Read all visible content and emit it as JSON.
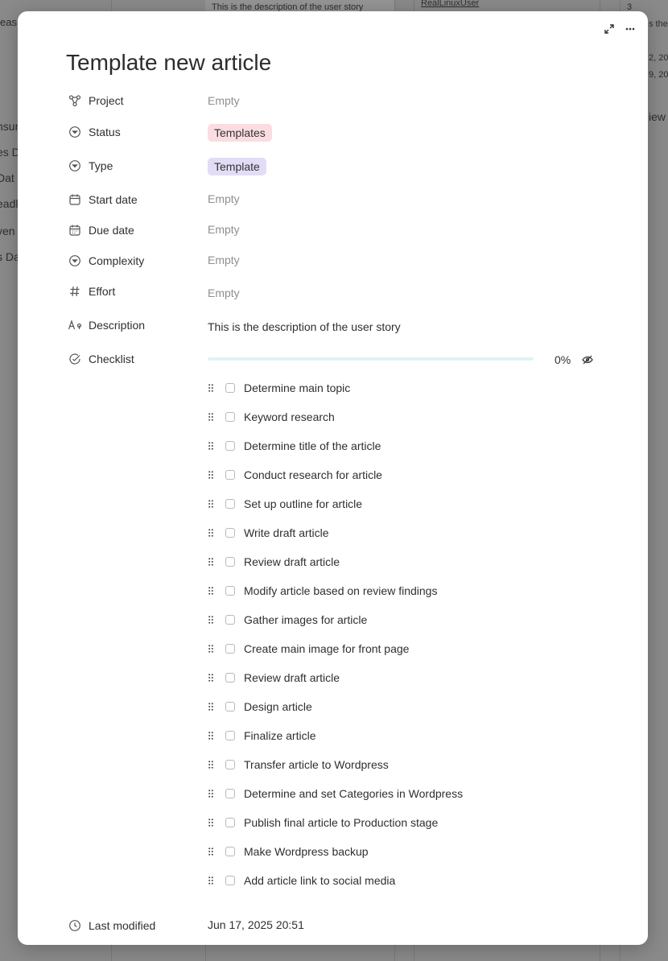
{
  "background": {
    "top_description": "This is the description of the user story",
    "top_user_link": "RealLinuxUser",
    "top_count": "3",
    "right_text_1": "s the",
    "right_date_1": "2, 20",
    "right_date_2": "9, 20",
    "right_view": "iew",
    "left_top": "eas",
    "left_items": [
      "nsur",
      "es D",
      "Dat",
      "eadl",
      "ven",
      "s Da"
    ]
  },
  "modal": {
    "title": "Template new article",
    "properties": {
      "project": {
        "label": "Project",
        "value": "Empty",
        "icon": "project-icon"
      },
      "status": {
        "label": "Status",
        "value": "Templates",
        "icon": "status-icon",
        "color": "#fbdde1"
      },
      "type": {
        "label": "Type",
        "value": "Template",
        "icon": "type-icon",
        "color": "#e3dcf7"
      },
      "start_date": {
        "label": "Start date",
        "value": "Empty",
        "icon": "calendar-icon"
      },
      "due_date": {
        "label": "Due date",
        "value": "Empty",
        "icon": "calendar-due-icon"
      },
      "complexity": {
        "label": "Complexity",
        "value": "Empty",
        "icon": "select-icon"
      },
      "effort": {
        "label": "Effort",
        "value": "Empty",
        "icon": "hash-icon"
      },
      "description": {
        "label": "Description",
        "value": "This is the description of the user story",
        "icon": "text-icon"
      },
      "checklist": {
        "label": "Checklist",
        "progress_label": "0%",
        "progress": 0,
        "icon": "check-circle-icon"
      },
      "last_modified": {
        "label": "Last modified",
        "value": "Jun 17, 2025 20:51",
        "icon": "clock-icon"
      }
    },
    "checklist_items": [
      "Determine main topic",
      "Keyword research",
      "Determine title of the article",
      "Conduct research for article",
      "Set up outline for article",
      "Write draft article",
      "Review draft article",
      "Modify article based on review findings",
      "Gather images for article",
      "Create main image for front page",
      "Review draft article",
      "Design article",
      "Finalize article",
      "Transfer article to Wordpress",
      "Determine and set Categories in Wordpress",
      "Publish final article to Production stage",
      "Make Wordpress backup",
      "Add article link to social media"
    ]
  }
}
